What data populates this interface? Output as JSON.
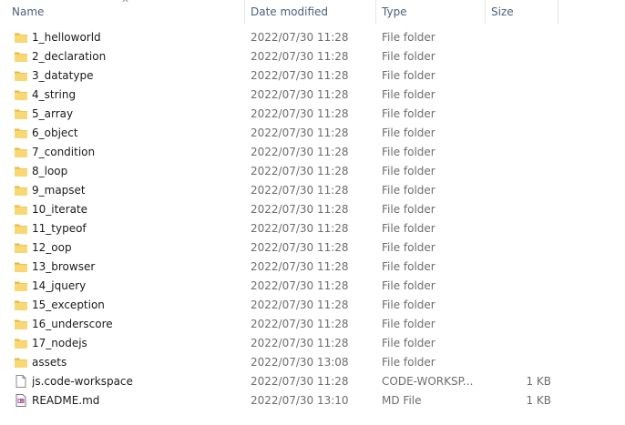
{
  "columns": {
    "name": "Name",
    "date_modified": "Date modified",
    "type": "Type",
    "size": "Size",
    "sort_indicator": "^"
  },
  "colors": {
    "folder": "#f8d775",
    "folder_shade": "#e8b63e",
    "header_text": "#4c607a",
    "secondary_text": "#6d6d6d"
  },
  "files": [
    {
      "name": "1_helloworld",
      "date": "2022/07/30 11:28",
      "type": "File folder",
      "size": "",
      "icon": "folder-icon"
    },
    {
      "name": "2_declaration",
      "date": "2022/07/30 11:28",
      "type": "File folder",
      "size": "",
      "icon": "folder-icon"
    },
    {
      "name": "3_datatype",
      "date": "2022/07/30 11:28",
      "type": "File folder",
      "size": "",
      "icon": "folder-icon"
    },
    {
      "name": "4_string",
      "date": "2022/07/30 11:28",
      "type": "File folder",
      "size": "",
      "icon": "folder-icon"
    },
    {
      "name": "5_array",
      "date": "2022/07/30 11:28",
      "type": "File folder",
      "size": "",
      "icon": "folder-icon"
    },
    {
      "name": "6_object",
      "date": "2022/07/30 11:28",
      "type": "File folder",
      "size": "",
      "icon": "folder-icon"
    },
    {
      "name": "7_condition",
      "date": "2022/07/30 11:28",
      "type": "File folder",
      "size": "",
      "icon": "folder-icon"
    },
    {
      "name": "8_loop",
      "date": "2022/07/30 11:28",
      "type": "File folder",
      "size": "",
      "icon": "folder-icon"
    },
    {
      "name": "9_mapset",
      "date": "2022/07/30 11:28",
      "type": "File folder",
      "size": "",
      "icon": "folder-icon"
    },
    {
      "name": "10_iterate",
      "date": "2022/07/30 11:28",
      "type": "File folder",
      "size": "",
      "icon": "folder-icon"
    },
    {
      "name": "11_typeof",
      "date": "2022/07/30 11:28",
      "type": "File folder",
      "size": "",
      "icon": "folder-icon"
    },
    {
      "name": "12_oop",
      "date": "2022/07/30 11:28",
      "type": "File folder",
      "size": "",
      "icon": "folder-icon"
    },
    {
      "name": "13_browser",
      "date": "2022/07/30 11:28",
      "type": "File folder",
      "size": "",
      "icon": "folder-icon"
    },
    {
      "name": "14_jquery",
      "date": "2022/07/30 11:28",
      "type": "File folder",
      "size": "",
      "icon": "folder-icon"
    },
    {
      "name": "15_exception",
      "date": "2022/07/30 11:28",
      "type": "File folder",
      "size": "",
      "icon": "folder-icon"
    },
    {
      "name": "16_underscore",
      "date": "2022/07/30 11:28",
      "type": "File folder",
      "size": "",
      "icon": "folder-icon"
    },
    {
      "name": "17_nodejs",
      "date": "2022/07/30 11:28",
      "type": "File folder",
      "size": "",
      "icon": "folder-icon"
    },
    {
      "name": "assets",
      "date": "2022/07/30 13:08",
      "type": "File folder",
      "size": "",
      "icon": "folder-icon"
    },
    {
      "name": "js.code-workspace",
      "date": "2022/07/30 11:28",
      "type": "CODE-WORKSP...",
      "size": "1 KB",
      "icon": "document-icon"
    },
    {
      "name": "README.md",
      "date": "2022/07/30 13:10",
      "type": "MD File",
      "size": "1 KB",
      "icon": "markdown-file-icon"
    }
  ]
}
